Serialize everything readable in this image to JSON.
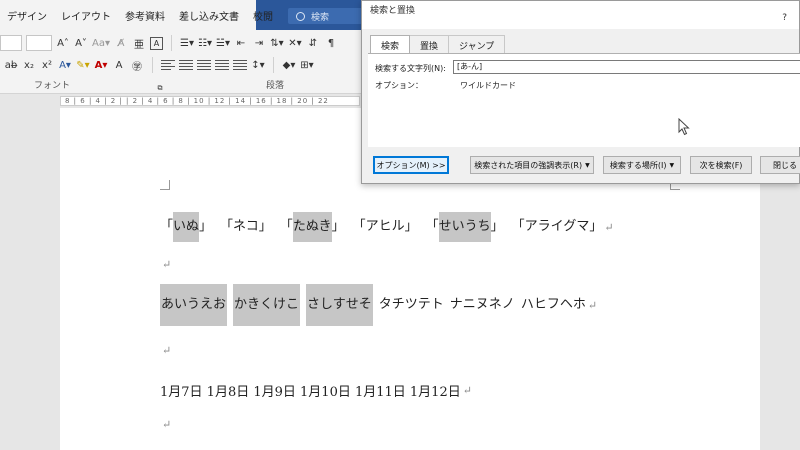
{
  "ribbon_tabs": [
    "デザイン",
    "レイアウト",
    "参考資料",
    "差し込み文書",
    "校閲"
  ],
  "search": {
    "placeholder": "検索"
  },
  "ribbon": {
    "font_name": "",
    "font_size": "",
    "font_group_label": "フォント",
    "paragraph_group_label": "段落"
  },
  "ruler_text": "8 | 6 | 4 | 2 | | 2 | 4 | 6 | 8 | 10 | 12 | 14 | 16 | 18 | 20 | 22",
  "dialog": {
    "title": "検索と置換",
    "help": "?",
    "tabs": [
      {
        "label": "検索",
        "active": true
      },
      {
        "label": "置換",
        "active": false
      },
      {
        "label": "ジャンプ",
        "active": false
      }
    ],
    "find_label": "検索する文字列(N):",
    "find_value": "[あ-ん]",
    "options_label": "オプション：",
    "options_value": "ワイルドカード",
    "buttons": {
      "options": "オプション(M) >>",
      "highlight": "検索された項目の強調表示(R)",
      "find_in": "検索する場所(I)",
      "find_next": "次を検索(F)",
      "close": "閉じる"
    }
  },
  "document": {
    "line1": [
      {
        "text": "「",
        "hl": false
      },
      {
        "text": "いぬ",
        "hl": true
      },
      {
        "text": "」",
        "hl": false
      },
      {
        "text": "「ネコ」",
        "hl": false
      },
      {
        "text": "「",
        "hl": false
      },
      {
        "text": "たぬき",
        "hl": true
      },
      {
        "text": "」",
        "hl": false
      },
      {
        "text": "「アヒル」",
        "hl": false
      },
      {
        "text": "「",
        "hl": false
      },
      {
        "text": "せいうち",
        "hl": true
      },
      {
        "text": "」",
        "hl": false
      },
      {
        "text": "「アライグマ」",
        "hl": false
      }
    ],
    "line2": [
      {
        "text": "あいうえお",
        "hl": true
      },
      {
        "text": "かきくけこ",
        "hl": true
      },
      {
        "text": "さしすせそ",
        "hl": true
      },
      {
        "text": "タチツテト",
        "hl": false
      },
      {
        "text": "ナニヌネノ",
        "hl": false
      },
      {
        "text": "ハヒフヘホ",
        "hl": false
      }
    ],
    "line3": "1月7日 1月8日 1月9日 1月10日 1月11日 1月12日",
    "pilcrow": "↵"
  },
  "colors": {
    "accent": "#2b579a",
    "highlight": "#c6c6c6",
    "dialog_primary": "#0078d7"
  }
}
